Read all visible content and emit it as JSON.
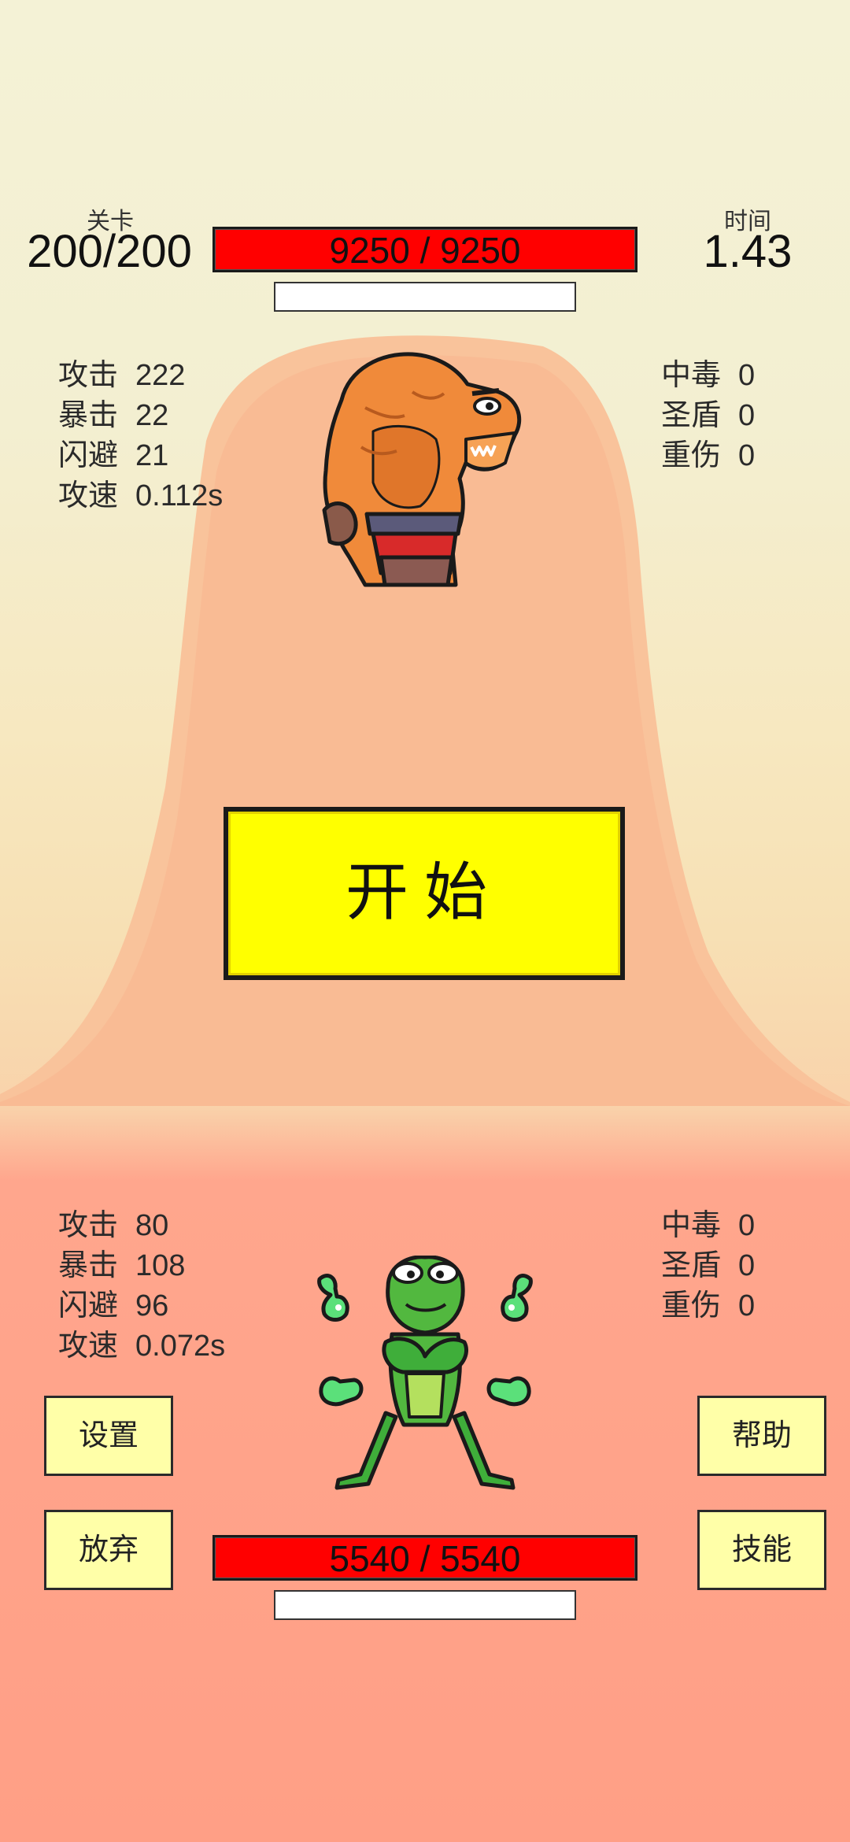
{
  "level": {
    "label": "关卡",
    "value": "200/200"
  },
  "timer": {
    "label": "时间",
    "value": "1.43"
  },
  "enemy": {
    "hp_text": "9250 / 9250",
    "hp_fraction": 1.0,
    "stats_left": [
      {
        "name": "攻击",
        "value": "222"
      },
      {
        "name": "暴击",
        "value": "22"
      },
      {
        "name": "闪避",
        "value": "21"
      },
      {
        "name": "攻速",
        "value": "0.112s"
      }
    ],
    "stats_right": [
      {
        "name": "中毒",
        "value": "0"
      },
      {
        "name": "圣盾",
        "value": "0"
      },
      {
        "name": "重伤",
        "value": "0"
      }
    ],
    "sprite": "orange-dinosaur-monster-icon"
  },
  "start_button": {
    "label": "开始"
  },
  "player": {
    "hp_text": "5540 / 5540",
    "hp_fraction": 1.0,
    "stats_left": [
      {
        "name": "攻击",
        "value": "80"
      },
      {
        "name": "暴击",
        "value": "108"
      },
      {
        "name": "闪避",
        "value": "96"
      },
      {
        "name": "攻速",
        "value": "0.072s"
      }
    ],
    "stats_right": [
      {
        "name": "中毒",
        "value": "0"
      },
      {
        "name": "圣盾",
        "value": "0"
      },
      {
        "name": "重伤",
        "value": "0"
      }
    ],
    "sprite": "green-frog-fighter-icon"
  },
  "buttons": {
    "settings": "设置",
    "give_up": "放弃",
    "help": "帮助",
    "skills": "技能"
  },
  "colors": {
    "hp_bar": "#ff0000",
    "start_button": "#ffff00",
    "menu_button": "#ffffa8"
  }
}
